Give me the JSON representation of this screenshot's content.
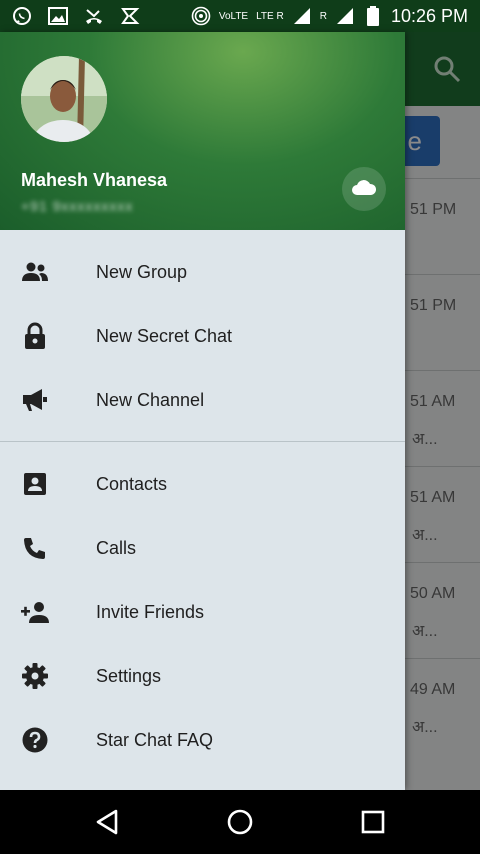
{
  "status_bar": {
    "time": "10:26 PM",
    "volte": "VoLTE",
    "lte": "LTE R",
    "roaming": "R",
    "icons": [
      "whatsapp-icon",
      "gallery-icon",
      "missed-call-icon",
      "app-icon",
      "hotspot-icon",
      "signal-icon",
      "battery-icon"
    ]
  },
  "background_chat_list": {
    "button_text": "e",
    "rows": [
      {
        "time": "51 PM",
        "snippet": ""
      },
      {
        "time": "51 PM",
        "snippet": ""
      },
      {
        "time": "51 AM",
        "snippet": "अ..."
      },
      {
        "time": "51 AM",
        "snippet": "अ..."
      },
      {
        "time": "50 AM",
        "snippet": "अ..."
      },
      {
        "time": "49 AM",
        "snippet": "अ..."
      }
    ]
  },
  "drawer": {
    "user_name": "Mahesh Vhanesa",
    "user_phone": "+91 9xxxxxxxxx",
    "menu_group_1": [
      {
        "label": "New Group",
        "icon": "group-icon"
      },
      {
        "label": "New Secret Chat",
        "icon": "lock-icon"
      },
      {
        "label": "New Channel",
        "icon": "megaphone-icon"
      }
    ],
    "menu_group_2": [
      {
        "label": "Contacts",
        "icon": "contacts-icon"
      },
      {
        "label": "Calls",
        "icon": "phone-icon"
      },
      {
        "label": "Invite Friends",
        "icon": "add-person-icon"
      },
      {
        "label": "Settings",
        "icon": "gear-icon"
      },
      {
        "label": "Star Chat FAQ",
        "icon": "help-icon"
      }
    ]
  },
  "colors": {
    "header_green": "#2e7a38",
    "drawer_bg": "#dde5ea",
    "status_bar": "#0f3d19"
  }
}
